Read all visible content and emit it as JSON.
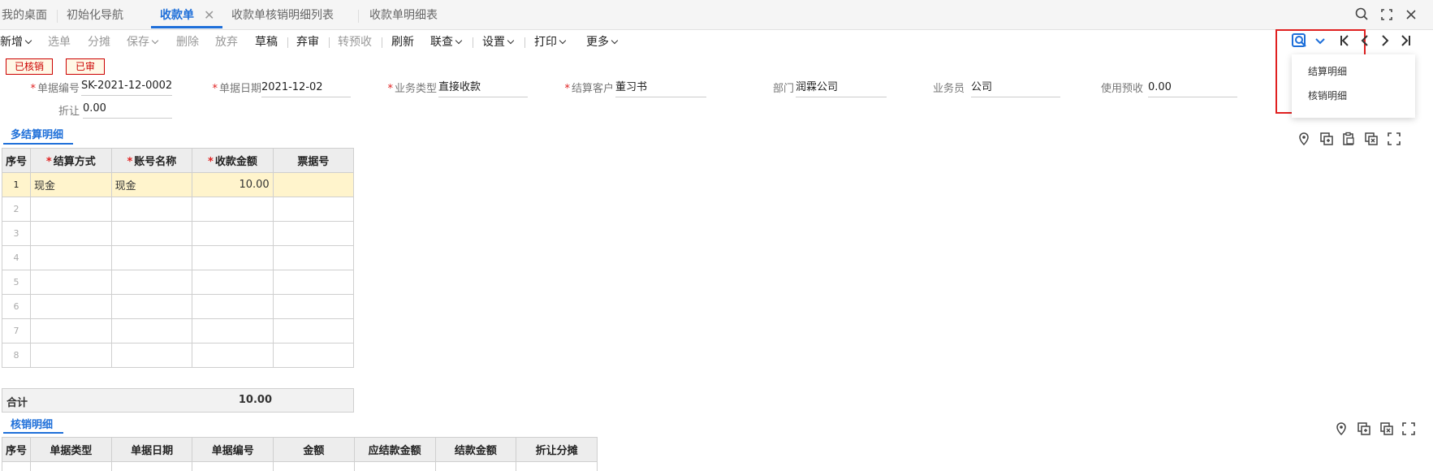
{
  "tabs": [
    {
      "label": "我的桌面"
    },
    {
      "label": "初始化导航"
    },
    {
      "label": "收款单"
    },
    {
      "label": "收款单核销明细列表"
    },
    {
      "label": "收款单明细表"
    }
  ],
  "toolbar": {
    "new": "新增",
    "select_doc": "选单",
    "split": "分摊",
    "save": "保存",
    "delete": "删除",
    "discard": "放弃",
    "draft": "草稿",
    "unreview": "弃审",
    "to_prepay": "转预收",
    "refresh": "刷新",
    "link_query": "联查",
    "settings": "设置",
    "print": "打印",
    "more": "更多"
  },
  "query_dropdown": {
    "items": [
      "结算明细",
      "核销明细"
    ]
  },
  "badges": {
    "verified": "已核销",
    "reviewed": "已审"
  },
  "form": {
    "doc_no_label": "单据编号",
    "doc_no": "SK-2021-12-0002",
    "doc_date_label": "单据日期",
    "doc_date": "2021-12-02",
    "biz_type_label": "业务类型",
    "biz_type": "直接收款",
    "customer_label": "结算客户",
    "customer": "董习书",
    "dept_label": "部门",
    "dept": "润霖公司",
    "salesman_label": "业务员",
    "salesman": "公司",
    "prepay_label": "使用预收",
    "prepay": "0.00",
    "discount_label": "折让",
    "discount": "0.00"
  },
  "settlement": {
    "title": "多结算明细",
    "headers": [
      "序号",
      "结算方式",
      "账号名称",
      "收款金额",
      "票据号"
    ],
    "rows": [
      {
        "no": "1",
        "method": "现金",
        "account": "现金",
        "amount": "10.00",
        "bill": ""
      },
      {
        "no": "2",
        "method": "",
        "account": "",
        "amount": "",
        "bill": ""
      },
      {
        "no": "3",
        "method": "",
        "account": "",
        "amount": "",
        "bill": ""
      },
      {
        "no": "4",
        "method": "",
        "account": "",
        "amount": "",
        "bill": ""
      },
      {
        "no": "5",
        "method": "",
        "account": "",
        "amount": "",
        "bill": ""
      },
      {
        "no": "6",
        "method": "",
        "account": "",
        "amount": "",
        "bill": ""
      },
      {
        "no": "7",
        "method": "",
        "account": "",
        "amount": "",
        "bill": ""
      },
      {
        "no": "8",
        "method": "",
        "account": "",
        "amount": "",
        "bill": ""
      }
    ],
    "total_label": "合计",
    "total_amount": "10.00"
  },
  "verification": {
    "title": "核销明细",
    "headers": [
      "序号",
      "单据类型",
      "单据日期",
      "单据编号",
      "金额",
      "应结款金额",
      "结款金额",
      "折让分摊"
    ]
  },
  "colors": {
    "accent": "#1e6fd9",
    "highlight_red": "#e02020",
    "selected_row": "#fff4cc"
  }
}
